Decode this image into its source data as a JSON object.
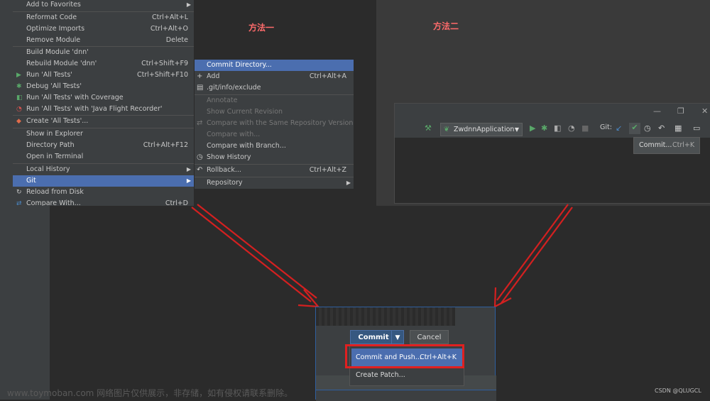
{
  "labels": {
    "method_one": "方法一",
    "method_two": "方法二"
  },
  "context_menu": {
    "items": [
      {
        "label": "Add to Favorites"
      },
      {
        "label": "Reformat Code",
        "shortcut": "Ctrl+Alt+L"
      },
      {
        "label": "Optimize Imports",
        "shortcut": "Ctrl+Alt+O"
      },
      {
        "label": "Remove Module",
        "shortcut": "Delete"
      },
      {
        "label": "Build Module 'dnn'"
      },
      {
        "label": "Rebuild Module 'dnn'",
        "shortcut": "Ctrl+Shift+F9"
      },
      {
        "label": "Run 'All Tests'",
        "shortcut": "Ctrl+Shift+F10"
      },
      {
        "label": "Debug 'All Tests'"
      },
      {
        "label": "Run 'All Tests' with Coverage"
      },
      {
        "label": "Run 'All Tests' with 'Java Flight Recorder'"
      },
      {
        "label": "Create 'All Tests'..."
      },
      {
        "label": "Show in Explorer"
      },
      {
        "label": "Directory Path",
        "shortcut": "Ctrl+Alt+F12"
      },
      {
        "label": "Open in Terminal"
      },
      {
        "label": "Local History"
      },
      {
        "label": "Git"
      },
      {
        "label": "Reload from Disk"
      },
      {
        "label": "Compare With...",
        "shortcut": "Ctrl+D"
      }
    ]
  },
  "git_submenu": {
    "items": [
      {
        "label": "Commit Directory..."
      },
      {
        "label": "Add",
        "shortcut": "Ctrl+Alt+A"
      },
      {
        "label": ".git/info/exclude"
      },
      {
        "label": "Annotate"
      },
      {
        "label": "Show Current Revision"
      },
      {
        "label": "Compare with the Same Repository Version"
      },
      {
        "label": "Compare with..."
      },
      {
        "label": "Compare with Branch..."
      },
      {
        "label": "Show History"
      },
      {
        "label": "Rollback...",
        "shortcut": "Ctrl+Alt+Z"
      },
      {
        "label": "Repository"
      }
    ]
  },
  "ide_toolbar": {
    "run_config": "ZwdnnApplication",
    "git_label": "Git:",
    "commit_tooltip": "Commit...",
    "commit_tooltip_shortcut": "Ctrl+K"
  },
  "commit_dialog": {
    "commit_label": "Commit",
    "cancel_label": "Cancel",
    "commit_and_push": "Commit and Push...",
    "commit_and_push_shortcut": "Ctrl+Alt+K",
    "create_patch": "Create Patch..."
  },
  "watermark": {
    "left": "www.toymoban.com 网络图片仅供展示，非存储，如有侵权请联系删除。",
    "right": "CSDN @QLUGCL"
  },
  "colors": {
    "highlight": "#4b6eaf",
    "accent_red": "#e02020",
    "label_red": "#ff6b6b"
  }
}
